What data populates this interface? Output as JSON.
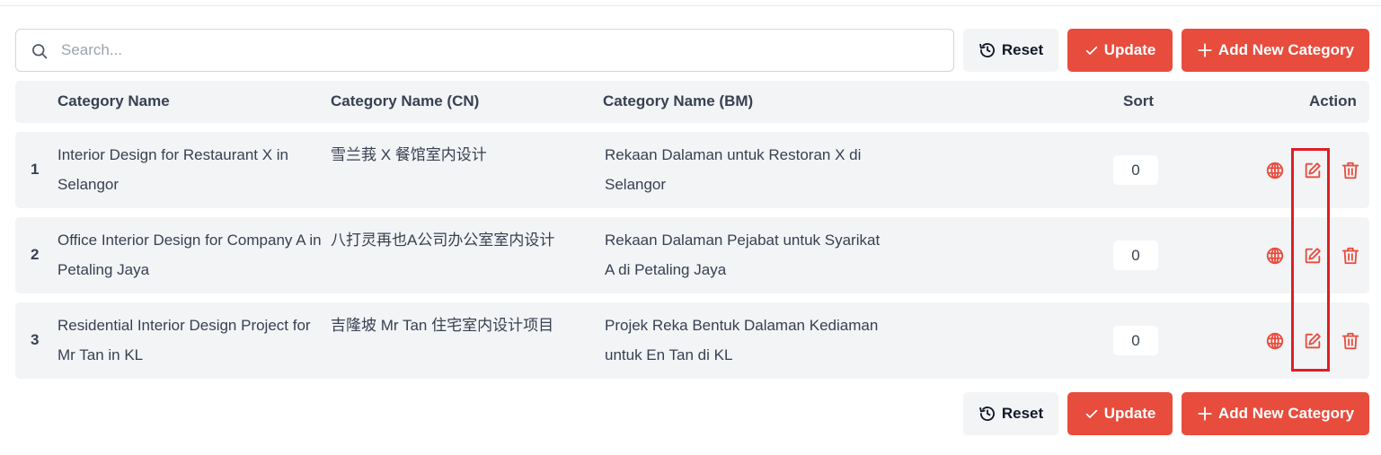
{
  "search": {
    "placeholder": "Search...",
    "value": ""
  },
  "toolbar": {
    "reset_label": "Reset",
    "update_label": "Update",
    "add_label": "Add New Category"
  },
  "table": {
    "headers": {
      "name": "Category Name",
      "cn": "Category Name (CN)",
      "bm": "Category Name (BM)",
      "sort": "Sort",
      "action": "Action"
    },
    "rows": [
      {
        "index": "1",
        "name": "Interior Design for Restaurant X in Selangor",
        "cn": "雪兰莪 X 餐馆室内设计",
        "bm": "Rekaan Dalaman untuk Restoran X di Selangor",
        "sort": "0"
      },
      {
        "index": "2",
        "name": "Office Interior Design for Company A in Petaling Jaya",
        "cn": "八打灵再也A公司办公室室内设计",
        "bm": "Rekaan Dalaman Pejabat untuk Syarikat A di Petaling Jaya",
        "sort": "0"
      },
      {
        "index": "3",
        "name": "Residential Interior Design Project for Mr Tan in KL",
        "cn": "吉隆坡 Mr Tan 住宅室内设计项目",
        "bm": "Projek Reka Bentuk Dalaman Kediaman untuk En Tan di KL",
        "sort": "0"
      }
    ]
  },
  "icons": {
    "search": "search-icon",
    "reset": "history-icon",
    "update": "check-icon",
    "add": "plus-icon",
    "translate": "globe-icon",
    "edit": "edit-icon",
    "delete": "trash-icon"
  },
  "colors": {
    "accent": "#e84c3d",
    "highlight": "#e11d26",
    "row_bg": "#f3f4f6"
  }
}
